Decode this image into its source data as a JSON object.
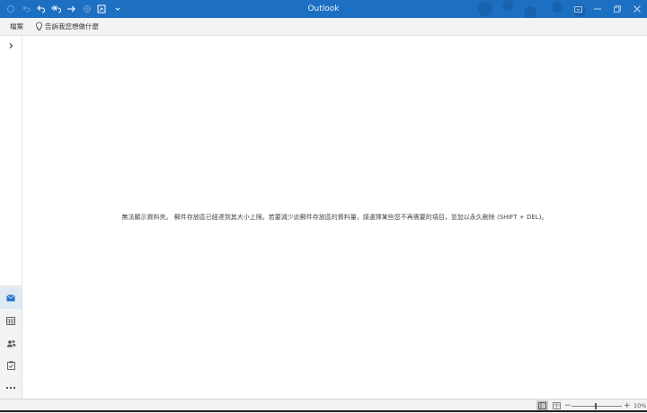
{
  "window": {
    "title": "Outlook"
  },
  "menubar": {
    "file_label": "檔案",
    "tell_me": "告訴我您想做什麼"
  },
  "main": {
    "message": "無法顯示資料夾。 郵件存放區已經達到其大小上限。若要減少此郵件存放區的資料量，請選擇某些您不再需要的項目，並加以永久刪除 (SHIFT + DEL)。"
  },
  "statusbar": {
    "zoom_level": "10%"
  },
  "colors": {
    "titlebar": "#1d6fc2",
    "accent": "#1d6fc2"
  },
  "icons": {
    "qat": [
      "send-receive-icon",
      "undo-icon",
      "reply-icon",
      "reply-all-icon",
      "forward-icon",
      "sync-icon",
      "touch-mode-icon",
      "customize-qat-icon"
    ],
    "nav": [
      "mail-icon",
      "calendar-icon",
      "people-icon",
      "tasks-icon",
      "more-icon"
    ]
  }
}
